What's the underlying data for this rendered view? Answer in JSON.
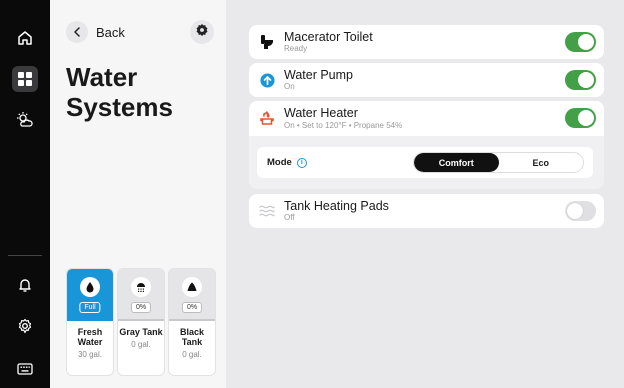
{
  "nav": {
    "items": [
      {
        "icon": "home-icon"
      },
      {
        "icon": "grid-icon",
        "active": true
      },
      {
        "icon": "sun-cloud-icon"
      }
    ],
    "bottom": [
      {
        "icon": "bell-icon"
      },
      {
        "icon": "gear-icon"
      },
      {
        "icon": "keyboard-icon"
      }
    ]
  },
  "header": {
    "back_label": "Back",
    "title": "Water Systems"
  },
  "tanks": [
    {
      "name": "Fresh Water",
      "level": "Full",
      "amount": "30 gal.",
      "active": true
    },
    {
      "name": "Gray Tank",
      "level": "0%",
      "amount": "0 gal."
    },
    {
      "name": "Black Tank",
      "level": "0%",
      "amount": "0 gal."
    }
  ],
  "systems": {
    "macerator": {
      "title": "Macerator Toilet",
      "status": "Ready",
      "on": true
    },
    "pump": {
      "title": "Water Pump",
      "status": "On",
      "on": true
    },
    "heater": {
      "title": "Water Heater",
      "status": "On • Set to 120°F • Propane 54%",
      "on": true
    },
    "pads": {
      "title": "Tank Heating Pads",
      "status": "Off",
      "on": false
    }
  },
  "mode": {
    "label": "Mode",
    "options": [
      "Comfort",
      "Eco"
    ],
    "selected": "Comfort"
  },
  "colors": {
    "accent": "#1996d8",
    "toggle_on": "#43a047",
    "heater_icon": "#e8542a"
  }
}
